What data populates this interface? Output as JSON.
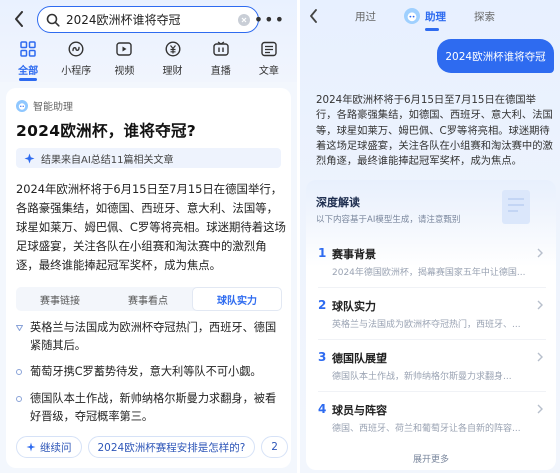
{
  "left": {
    "search": {
      "query": "2024欧洲杯谁将夺冠"
    },
    "more": "•••",
    "tabs": [
      {
        "label": "全部",
        "icon": "grid-icon",
        "active": true
      },
      {
        "label": "小程序",
        "icon": "miniprogram-icon",
        "active": false
      },
      {
        "label": "视频",
        "icon": "video-icon",
        "active": false
      },
      {
        "label": "理财",
        "icon": "finance-icon",
        "active": false
      },
      {
        "label": "直播",
        "icon": "live-icon",
        "active": false
      },
      {
        "label": "文章",
        "icon": "article-icon",
        "active": false
      }
    ],
    "assistant_label": "智能助理",
    "question_title": "2024欧洲杯，谁将夺冠?",
    "source_note": "结果来自AI总结11篇相关文章",
    "answer": "2024年欧洲杯将于6月15日至7月15日在德国举行，各路豪强集结，如德国、西班牙、意大利、法国等，球星如莱万、姆巴佩、C罗等将亮相。球迷期待着这场足球盛宴，关注各队在小组赛和淘汰赛中的激烈角逐，最终谁能捧起冠军奖杯，成为焦点。",
    "subtabs": [
      {
        "label": "赛事链接",
        "active": false
      },
      {
        "label": "赛事看点",
        "active": false
      },
      {
        "label": "球队实力",
        "active": true
      }
    ],
    "bullets": [
      "英格兰与法国成为欧洲杯夺冠热门，西班牙、德国紧随其后。",
      "葡萄牙携C罗蓄势待发，意大利等队不可小觑。",
      "德国队本土作战，新帅纳格尔斯曼力求翻身，被看好晋级，夺冠概率第三。"
    ],
    "chips": [
      {
        "label": "继续问",
        "icon": "sparkle-icon"
      },
      {
        "label": "2024欧洲杯赛程安排是怎样的?",
        "icon": ""
      },
      {
        "label": "2",
        "icon": ""
      }
    ]
  },
  "right": {
    "tabs": [
      {
        "label": "用过",
        "active": false
      },
      {
        "label": "助理",
        "active": true
      },
      {
        "label": "探索",
        "active": false
      }
    ],
    "user_bubble": "2024欧洲杯谁将夺冠",
    "answer": "2024年欧洲杯将于6月15日至7月15日在德国举行，各路豪强集结，如德国、西班牙、意大利、法国等，球星如莱万、姆巴佩、C罗等将亮相。球迷期待着这场足球盛宴，关注各队在小组赛和淘汰赛中的激烈角逐，最终谁能捧起冠军奖杯，成为焦点。",
    "deep": {
      "title": "深度解读",
      "subtitle": "以下内容基于AI模型生成，请注意甄别",
      "items": [
        {
          "num": "1",
          "title": "赛事背景",
          "desc": "2024年德国欧洲杯，揭幕赛国家五年中让德国..."
        },
        {
          "num": "2",
          "title": "球队实力",
          "desc": "英格兰与法国成为欧洲杯夺冠热门，西班牙、..."
        },
        {
          "num": "3",
          "title": "德国队展望",
          "desc": "德国队本土作战，新帅纳格尔斯曼力求翻身..."
        },
        {
          "num": "4",
          "title": "球员与阵容",
          "desc": "德国、西班牙、荷兰和葡萄牙让各自新的阵容..."
        }
      ],
      "expand": "展开更多"
    }
  }
}
